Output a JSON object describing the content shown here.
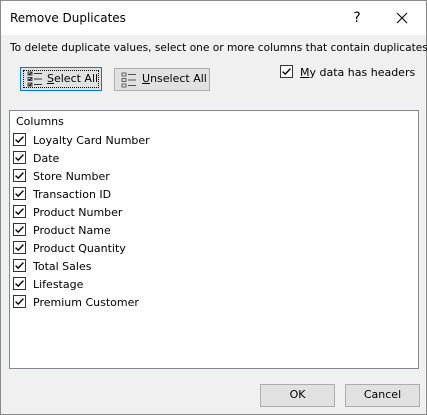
{
  "window": {
    "title": "Remove Duplicates",
    "help_label": "?",
    "close_icon": "close-icon"
  },
  "instruction": "To delete duplicate values, select one or more columns that contain duplicates.",
  "toolbar": {
    "select_all_pre": "",
    "select_all_mnemonic": "S",
    "select_all_post": "elect All",
    "unselect_all_pre": "",
    "unselect_all_mnemonic": "U",
    "unselect_all_post": "nselect All",
    "headers_pre": "",
    "headers_mnemonic": "M",
    "headers_post": "y data has headers",
    "headers_checked": true
  },
  "columns": {
    "header": "Columns",
    "items": [
      {
        "label": "Loyalty Card Number",
        "checked": true
      },
      {
        "label": "Date",
        "checked": true
      },
      {
        "label": "Store Number",
        "checked": true
      },
      {
        "label": "Transaction ID",
        "checked": true
      },
      {
        "label": "Product Number",
        "checked": true
      },
      {
        "label": "Product Name",
        "checked": true
      },
      {
        "label": "Product Quantity",
        "checked": true
      },
      {
        "label": "Total Sales",
        "checked": true
      },
      {
        "label": "Lifestage",
        "checked": true
      },
      {
        "label": "Premium Customer",
        "checked": true
      }
    ]
  },
  "footer": {
    "ok_label": "OK",
    "cancel_label": "Cancel"
  },
  "colors": {
    "focus_border": "#0078d7",
    "button_face": "#e1e1e1",
    "dialog_bg": "#f0f0f0"
  }
}
